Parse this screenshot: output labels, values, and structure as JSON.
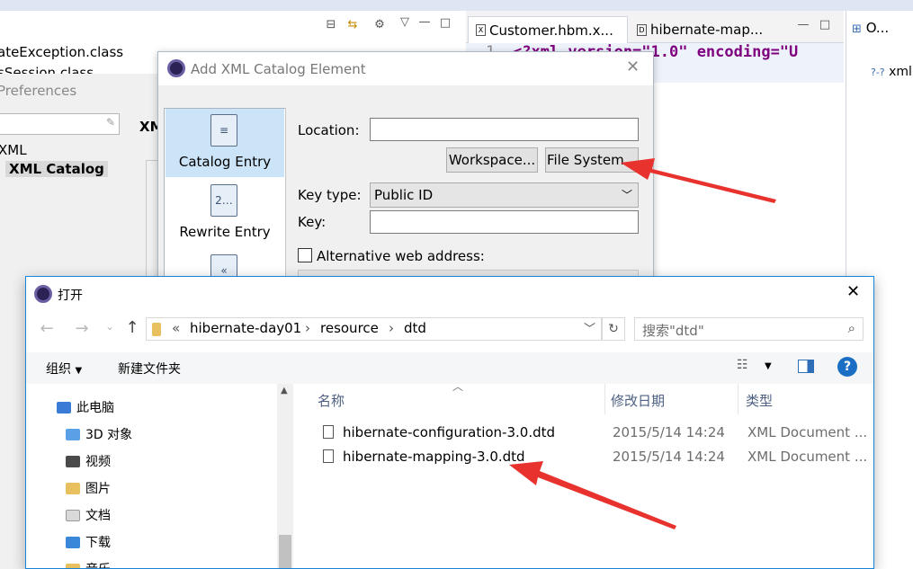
{
  "eclipse": {
    "left_view_items": [
      "ateException.class",
      "sSession.class"
    ],
    "editor_tabs": [
      {
        "label": "Customer.hbm.x...",
        "icon": "X"
      },
      {
        "label": "hibernate-map...",
        "icon": "D"
      }
    ],
    "editor_code": {
      "line_no": "1",
      "text": "<?xml version=\"1.0\" encoding=\"U"
    },
    "outline_tab": "O...",
    "outline_item": "xml"
  },
  "preferences": {
    "title": "Preferences",
    "tree_items": [
      "XML",
      "XML Catalog"
    ],
    "right_fragment": "XM"
  },
  "catalog_dialog": {
    "title": "Add XML Catalog Element",
    "entries": [
      "Catalog Entry",
      "Rewrite Entry"
    ],
    "location_label": "Location:",
    "location_value": "",
    "workspace_button": "Workspace...",
    "file_system_button": "File System...",
    "key_type_label": "Key type:",
    "key_type_value": "Public ID",
    "key_label": "Key:",
    "key_value": "",
    "alt_web_label": "Alternative web address:"
  },
  "open_dialog": {
    "title": "打开",
    "breadcrumb": [
      "hibernate-day01",
      "resource",
      "dtd"
    ],
    "breadcrumb_prefix": "«",
    "search_placeholder": "搜索\"dtd\"",
    "organize_label": "组织",
    "new_folder_label": "新建文件夹",
    "nav_items": [
      {
        "label": "此电脑",
        "color": "#3a7bd5"
      },
      {
        "label": "3D 对象",
        "color": "#5aa0e6"
      },
      {
        "label": "视频",
        "color": "#4a4a4a"
      },
      {
        "label": "图片",
        "color": "#e8c060"
      },
      {
        "label": "文档",
        "color": "#d9d9d9"
      },
      {
        "label": "下载",
        "color": "#3a86d9"
      },
      {
        "label": "音乐",
        "color": "#e8c060"
      }
    ],
    "columns": {
      "name": "名称",
      "modified": "修改日期",
      "type": "类型"
    },
    "files": [
      {
        "name": "hibernate-configuration-3.0.dtd",
        "modified": "2015/5/14 14:24",
        "type": "XML Document ..."
      },
      {
        "name": "hibernate-mapping-3.0.dtd",
        "modified": "2015/5/14 14:24",
        "type": "XML Document ..."
      }
    ]
  },
  "colors": {
    "arrow": "#e8322e",
    "accent": "#1883d7",
    "selection": "#cce4f7"
  }
}
